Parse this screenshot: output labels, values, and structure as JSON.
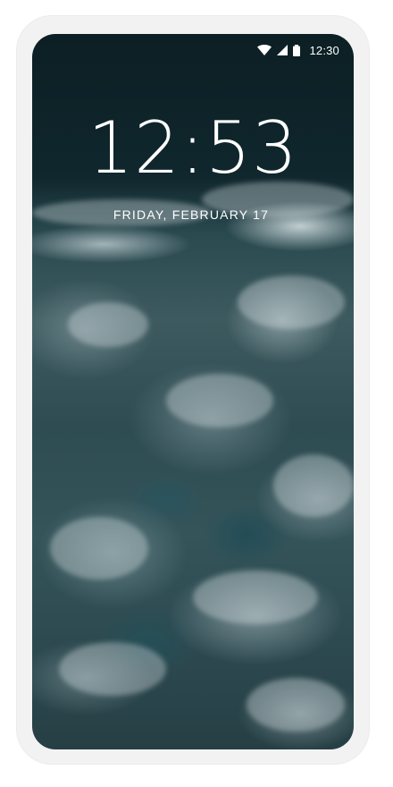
{
  "status_bar": {
    "time": "12:30",
    "icons": [
      "wifi-icon",
      "signal-icon",
      "battery-icon"
    ]
  },
  "lock_screen": {
    "clock": "12:53",
    "date": "FRIDAY, FEBRUARY 17",
    "wallpaper": "ocean-waves"
  },
  "colors": {
    "frame": "#f2f2f2",
    "text": "#ffffff",
    "wallpaper_dark": "#0c1f24",
    "wallpaper_teal": "#2d4a50"
  }
}
